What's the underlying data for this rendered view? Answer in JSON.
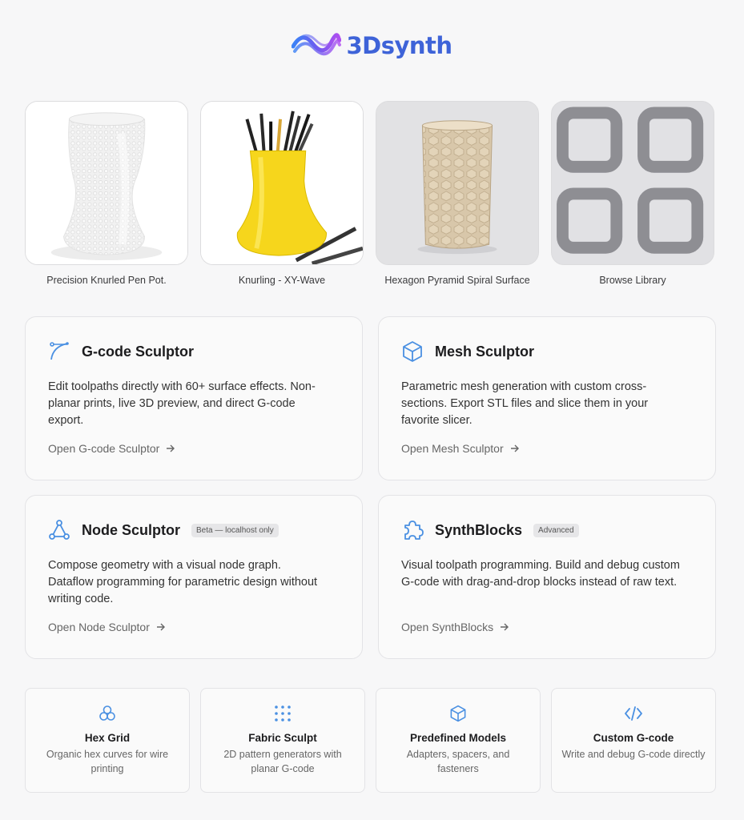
{
  "header": {
    "brand": "3Dsynth"
  },
  "gallery": [
    {
      "caption": "Precision Knurled Pen Pot."
    },
    {
      "caption": "Knurling - XY-Wave"
    },
    {
      "caption": "Hexagon Pyramid Spiral Surface"
    },
    {
      "caption": "Browse Library"
    }
  ],
  "tools": [
    {
      "title": "G-code Sculptor",
      "badge": "",
      "description": "Edit toolpaths directly with 60+ surface effects. Non-planar prints, live 3D preview, and direct G-code export.",
      "link": "Open G-code Sculptor"
    },
    {
      "title": "Mesh Sculptor",
      "badge": "",
      "description": "Parametric mesh generation with custom cross-sections. Export STL files and slice them in your favorite slicer.",
      "link": "Open Mesh Sculptor"
    },
    {
      "title": "Node Sculptor",
      "badge": "Beta — localhost only",
      "description": "Compose geometry with a visual node graph. Dataflow programming for parametric design without writing code.",
      "link": "Open Node Sculptor"
    },
    {
      "title": "SynthBlocks",
      "badge": "Advanced",
      "description": "Visual toolpath programming. Build and debug custom G-code with drag-and-drop blocks instead of raw text.",
      "link": "Open SynthBlocks"
    }
  ],
  "mini_tools": [
    {
      "title": "Hex Grid",
      "description": "Organic hex curves for wire printing"
    },
    {
      "title": "Fabric Sculpt",
      "description": "2D pattern generators with planar G-code"
    },
    {
      "title": "Predefined Models",
      "description": "Adapters, spacers, and fasteners"
    },
    {
      "title": "Custom G-code",
      "description": "Write and debug G-code directly"
    }
  ],
  "colors": {
    "accent": "#3e63d8",
    "icon": "#4a90e2"
  }
}
